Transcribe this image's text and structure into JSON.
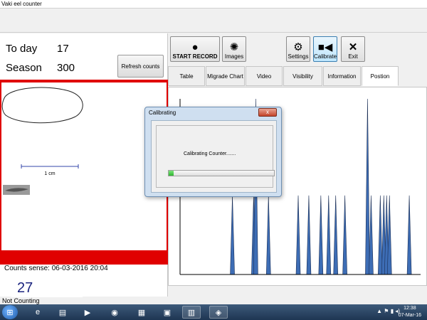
{
  "window": {
    "title": "Vaki eel counter"
  },
  "counts": {
    "today_label": "To day",
    "today_value": "17",
    "season_label": "Season",
    "season_value": "300",
    "refresh_label": "Refresh counts",
    "scale_label": "1 cm",
    "sense_text": "Counts sense: 06-03-2016 20:04",
    "current_count": "27"
  },
  "status": {
    "text": "Not Counting"
  },
  "toolbar": {
    "start_record": "START RECORD",
    "images": "Images",
    "settings": "Settings",
    "calibrate": "Calibrate",
    "exit": "Exit"
  },
  "tabs": [
    "Table",
    "Migrade Chart",
    "Video",
    "Visibility",
    "Information",
    "Postion"
  ],
  "selected_tab": "Postion",
  "dialog": {
    "title": "Calibrating",
    "close": "x",
    "message": "Calibrating Counter.......",
    "progress": 0.05
  },
  "chart_data": {
    "type": "bar",
    "x": [
      74,
      104,
      107,
      125,
      167,
      182,
      199,
      210,
      220,
      233,
      265,
      270,
      283,
      288,
      292,
      296,
      324
    ],
    "values": [
      45,
      45,
      100,
      45,
      45,
      45,
      45,
      45,
      45,
      45,
      100,
      45,
      45,
      45,
      45,
      45,
      45
    ],
    "xlim": [
      0,
      340
    ],
    "ylim": [
      0,
      100
    ],
    "grid": false,
    "bar_color": "#3d6db5"
  },
  "taskbar": {
    "start": "⊞",
    "apps": [
      "e",
      "▤",
      "▶",
      "◉",
      "▦",
      "▣",
      "▥",
      "◈"
    ],
    "tray": "▲ ⚑ ▮ ◂)",
    "time": "12:38",
    "date": "07-Mar-16"
  },
  "colors": {
    "accent_red": "#e00000",
    "count_blue": "#1a237e"
  }
}
